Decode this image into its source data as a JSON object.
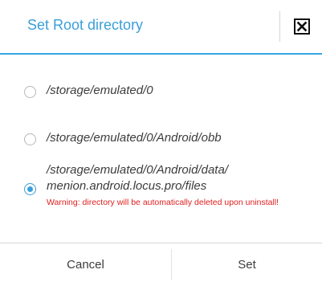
{
  "dialog": {
    "title": "Set Root directory",
    "options": [
      {
        "label": "/storage/emulated/0",
        "selected": false
      },
      {
        "label": "/storage/emulated/0/Android/obb",
        "selected": false
      },
      {
        "label_line1": "/storage/emulated/0/Android/data/",
        "label_line2": "menion.android.locus.pro/files",
        "selected": true
      }
    ],
    "warning": "Warning: directory will be automatically deleted upon uninstall!",
    "buttons": {
      "cancel": "Cancel",
      "set": "Set"
    }
  },
  "colors": {
    "accent": "#3a9fd9",
    "warning": "#e02020",
    "text": "#3c3c3c"
  },
  "icons": {
    "close": "close-icon"
  }
}
